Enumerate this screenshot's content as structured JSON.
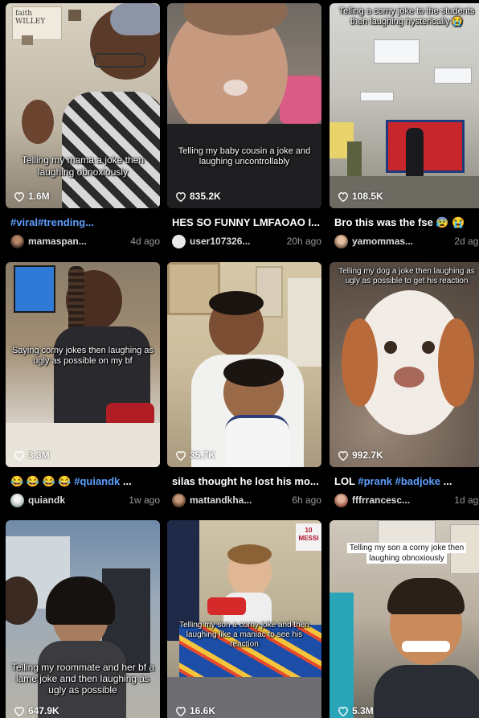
{
  "cards": [
    {
      "overlay": "Telling my mama a joke then laughing obnoxiously",
      "likes": "1.6M",
      "caption_tag": "#viral#trending...",
      "caption_text": "",
      "author": "mamaspan...",
      "age": "4d ago",
      "wall_text": "faith WILLEY"
    },
    {
      "overlay": "Telling my baby cousin a joke and laughing uncontrollably",
      "likes": "835.2K",
      "caption_text": "HES SO FUNNY LMFAOAO I...",
      "author": "user107326...",
      "age": "20h ago"
    },
    {
      "overlay": "Telling a corny joke to the students then laughing hysterically 😭",
      "likes": "108.5K",
      "caption_text": "Bro this was the fse 😰 😭",
      "author": "yamommas...",
      "age": "2d ago"
    },
    {
      "overlay": "Saying corny jokes then laughing as ugly as possible on my bf",
      "likes": "3.3M",
      "caption_emoji": "😂 😂 😂 😂",
      "caption_tag": "#quiandk",
      "caption_suffix": "...",
      "author": "quiandk",
      "age": "1w ago"
    },
    {
      "overlay": "",
      "likes": "35.7K",
      "caption_text": "silas thought he lost his mo...",
      "author": "mattandkha...",
      "age": "6h ago"
    },
    {
      "overlay": "Telling my dog a joke then laughing as ugly as possible to get his reaction",
      "likes": "992.7K",
      "caption_text": "LOL",
      "caption_tag": "#prank #badjoke",
      "caption_suffix": "...",
      "author": "fffrrancesc...",
      "age": "1d ago"
    },
    {
      "overlay": "Telling my roommate and her bf a lame joke and then laughing as ugly as possible",
      "likes": "647.9K"
    },
    {
      "overlay": "Telling my son a corny joke and then laughing like a maniac to see his reaction",
      "likes": "16.6K",
      "corner_text": "10 MESSI"
    },
    {
      "overlay": "Telling my son a corny joke then laughing obnoxiously",
      "likes": "5.3M"
    }
  ],
  "colors": {
    "hashtag": "#5ea0ff",
    "background": "#000000"
  }
}
